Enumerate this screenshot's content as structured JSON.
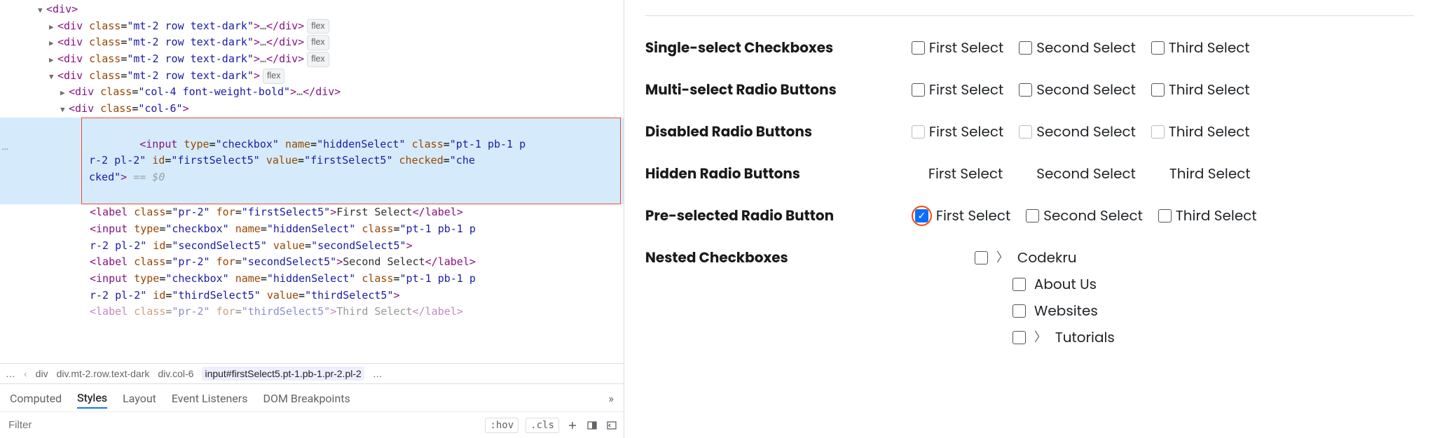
{
  "devtools": {
    "dom": {
      "root_open": "<div>",
      "row_div_open": "<div",
      "row_attrs": " class=\"mt-2 row text-dark\">",
      "ellipsis": "…",
      "row_close": "</div>",
      "flex_badge": "flex",
      "col4_open": "<div class=\"col-4 font-weight-bold\">",
      "col4_close": "</div>",
      "col6_open": "<div class=\"col-6\">",
      "hl_line": "<input type=\"checkbox\" name=\"hiddenSelect\" class=\"pt-1 pb-1 pr-2 pl-2\" id=\"firstSelect5\" value=\"firstSelect5\" checked=\"checked\">",
      "eq0": " == $0",
      "label_first": "<label class=\"pr-2\" for=\"firstSelect5\">First Select</label>",
      "input_second": "<input type=\"checkbox\" name=\"hiddenSelect\" class=\"pt-1 pb-1 pr-2 pl-2\" id=\"secondSelect5\" value=\"secondSelect5\">",
      "label_second": "<label class=\"pr-2\" for=\"secondSelect5\">Second Select</label>",
      "input_third": "<input type=\"checkbox\" name=\"hiddenSelect\" class=\"pt-1 pb-1 pr-2 pl-2\" id=\"thirdSelect5\" value=\"thirdSelect5\">",
      "label_third_partial": "<label class=\"pr-2\" for=\"thirdSelect5\">Third Select</label>"
    },
    "breadcrumb": [
      "…",
      "div",
      "div.mt-2.row.text-dark",
      "div.col-6",
      "input#firstSelect5.pt-1.pb-1.pr-2.pl-2",
      "…"
    ],
    "tabs": [
      "Computed",
      "Styles",
      "Layout",
      "Event Listeners",
      "DOM Breakpoints"
    ],
    "filter_placeholder": "Filter",
    "hov": ":hov",
    "cls": ".cls"
  },
  "form": {
    "rows": [
      {
        "label": "Single-select Checkboxes",
        "opts": [
          "First Select",
          "Second Select",
          "Third Select"
        ],
        "mode": "cb"
      },
      {
        "label": "Multi-select Radio Buttons",
        "opts": [
          "First Select",
          "Second Select",
          "Third Select"
        ],
        "mode": "cb"
      },
      {
        "label": "Disabled Radio Buttons",
        "opts": [
          "First Select",
          "Second Select",
          "Third Select"
        ],
        "mode": "disabled"
      },
      {
        "label": "Hidden Radio Buttons",
        "opts": [
          "First Select",
          "Second Select",
          "Third Select"
        ],
        "mode": "hidden"
      },
      {
        "label": "Pre-selected Radio Button",
        "opts": [
          "First Select",
          "Second Select",
          "Third Select"
        ],
        "mode": "preselect"
      },
      {
        "label": "Nested Checkboxes",
        "mode": "nested"
      }
    ],
    "nested": {
      "root": "Codekru",
      "children": [
        "About Us",
        "Websites",
        "Tutorials"
      ],
      "expandable": [
        true,
        false,
        false,
        true
      ]
    }
  }
}
